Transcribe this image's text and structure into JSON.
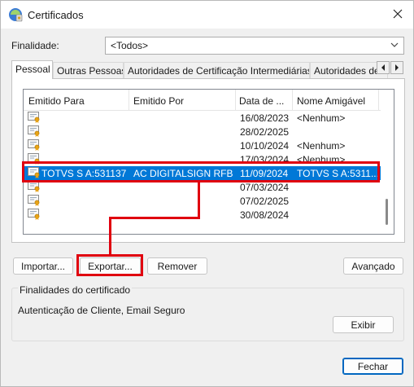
{
  "window": {
    "title": "Certificados",
    "close_label": "×"
  },
  "icons": {
    "title": "certificate-manager-icon",
    "close": "close-icon",
    "cert": "certificate-icon"
  },
  "purpose": {
    "label": "Finalidade:",
    "value": "<Todos>"
  },
  "tabs": [
    {
      "label": "Pessoal",
      "active": true
    },
    {
      "label": "Outras Pessoas"
    },
    {
      "label": "Autoridades de Certificação Intermediárias"
    },
    {
      "label": "Autoridades de Ce"
    }
  ],
  "columns": [
    "Emitido Para",
    "Emitido Por",
    "Data de ...",
    "Nome Amigável"
  ],
  "rows": [
    {
      "issued_to": "",
      "issued_by": "",
      "date": "16/08/2023",
      "friendly": "<Nenhum>"
    },
    {
      "issued_to": "",
      "issued_by": "",
      "date": "28/02/2025",
      "friendly": ""
    },
    {
      "issued_to": "",
      "issued_by": "",
      "date": "10/10/2024",
      "friendly": "<Nenhum>"
    },
    {
      "issued_to": "",
      "issued_by": "",
      "date": "17/03/2024",
      "friendly": "<Nenhum>"
    },
    {
      "issued_to": "TOTVS S A:531137...",
      "issued_by": "AC DIGITALSIGN RFB ...",
      "date": "11/09/2024",
      "friendly": "TOTVS S A:5311...",
      "selected": true
    },
    {
      "issued_to": "",
      "issued_by": "",
      "date": "07/03/2024",
      "friendly": ""
    },
    {
      "issued_to": "",
      "issued_by": "",
      "date": "07/02/2025",
      "friendly": ""
    },
    {
      "issued_to": "",
      "issued_by": "",
      "date": "30/08/2024",
      "friendly": ""
    }
  ],
  "buttons": {
    "import": "Importar...",
    "export": "Exportar...",
    "remove": "Remover",
    "advanced": "Avançado",
    "view": "Exibir",
    "close": "Fechar"
  },
  "purposes_group": {
    "title": "Finalidades do certificado",
    "text": "Autenticação de Cliente, Email Seguro"
  },
  "colors": {
    "selection": "#0078d7",
    "annotation": "#e0000f",
    "primary_border": "#0067c0"
  }
}
